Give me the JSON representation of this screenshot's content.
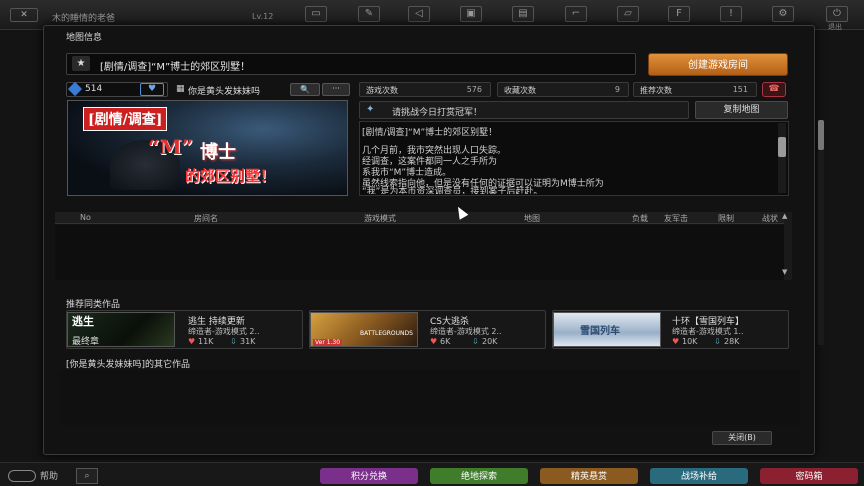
{
  "topbar": {
    "player_name": "木的睡情的老爸",
    "level": "Lv.12",
    "icons": [
      "monitor-icon",
      "edit-icon",
      "megaphone-icon",
      "briefcase-icon",
      "bag-icon",
      "gun-icon",
      "card-icon",
      "f-icon",
      "alert-icon",
      "settings-icon",
      "power-icon"
    ],
    "quit_label": "退出"
  },
  "modal": {
    "title": "地图信息",
    "map_title": "[剧情/调查]“M”博士的郊区别墅！",
    "create_room": "创建游戏房间",
    "rating": "514",
    "rate_button": "♥",
    "author": "你是黄头发妹妹吗",
    "author_search": "🔍",
    "author_more": "···",
    "stats": [
      {
        "label": "游戏次数",
        "value": "576"
      },
      {
        "label": "收藏次数",
        "value": "9"
      },
      {
        "label": "推荐次数",
        "value": "151"
      }
    ],
    "favorite_button": "☎",
    "image": {
      "tag": "[剧情/调查]",
      "m": "“M”",
      "bo": "博士",
      "sub": "的郊区别墅！"
    },
    "challenge": "请挑战今日打赏冠军！",
    "copy_map": "复制地图",
    "description": [
      "[剧情/调查]“M”博士的郊区别墅！",
      "几个月前，我市突然出现人口失踪。",
      "经调查，这案件都同一人之手所为",
      "系我市“M”博士造成。",
      "虽然线索指向他，但是没有任何的证据可以证明为M博士所为",
      "“我”是为本市资深调查员，接到案子后赶赴。",
      "发现事情并没有这么简单"
    ],
    "list_columns": [
      "No",
      "房间名",
      "游戏模式",
      "地图",
      "负载",
      "友军击",
      "限制",
      "战状"
    ],
    "recommend_title": "推荐同类作品",
    "cards": [
      {
        "title": "逃生 持续更新",
        "mode": "缔造者-游戏模式 2..",
        "likes": "11K",
        "downloads": "31K",
        "thumb_text": "逃生",
        "thumb_sub": "最终章"
      },
      {
        "title": "CS大逃杀",
        "mode": "缔造者-游戏模式 2..",
        "likes": "6K",
        "downloads": "20K",
        "thumb_text": "BATTLEGROUNDS",
        "thumb_sub": "Ver 1.30"
      },
      {
        "title": "十环【雪国列车】",
        "mode": "缔造者-游戏模式 1..",
        "likes": "10K",
        "downloads": "28K",
        "thumb_text": "雪国列车",
        "thumb_sub": ""
      }
    ],
    "others_title": "[你是黄头发妹妹吗]的其它作品",
    "close_button": "关闭(B)"
  },
  "bottombar": {
    "help": "帮助",
    "buttons": [
      {
        "label": "积分兑换",
        "color": "#7a2f8a"
      },
      {
        "label": "绝地探索",
        "color": "#3f7d2a"
      },
      {
        "label": "精英悬赏",
        "color": "#8a5a20"
      },
      {
        "label": "战场补给",
        "color": "#2a6a7d"
      },
      {
        "label": "密码箱",
        "color": "#8a2030"
      }
    ]
  },
  "colors": {
    "accent_orange": "#d07a2a",
    "rating_blue": "#3a7bd5",
    "image_red": "#cc2020"
  }
}
